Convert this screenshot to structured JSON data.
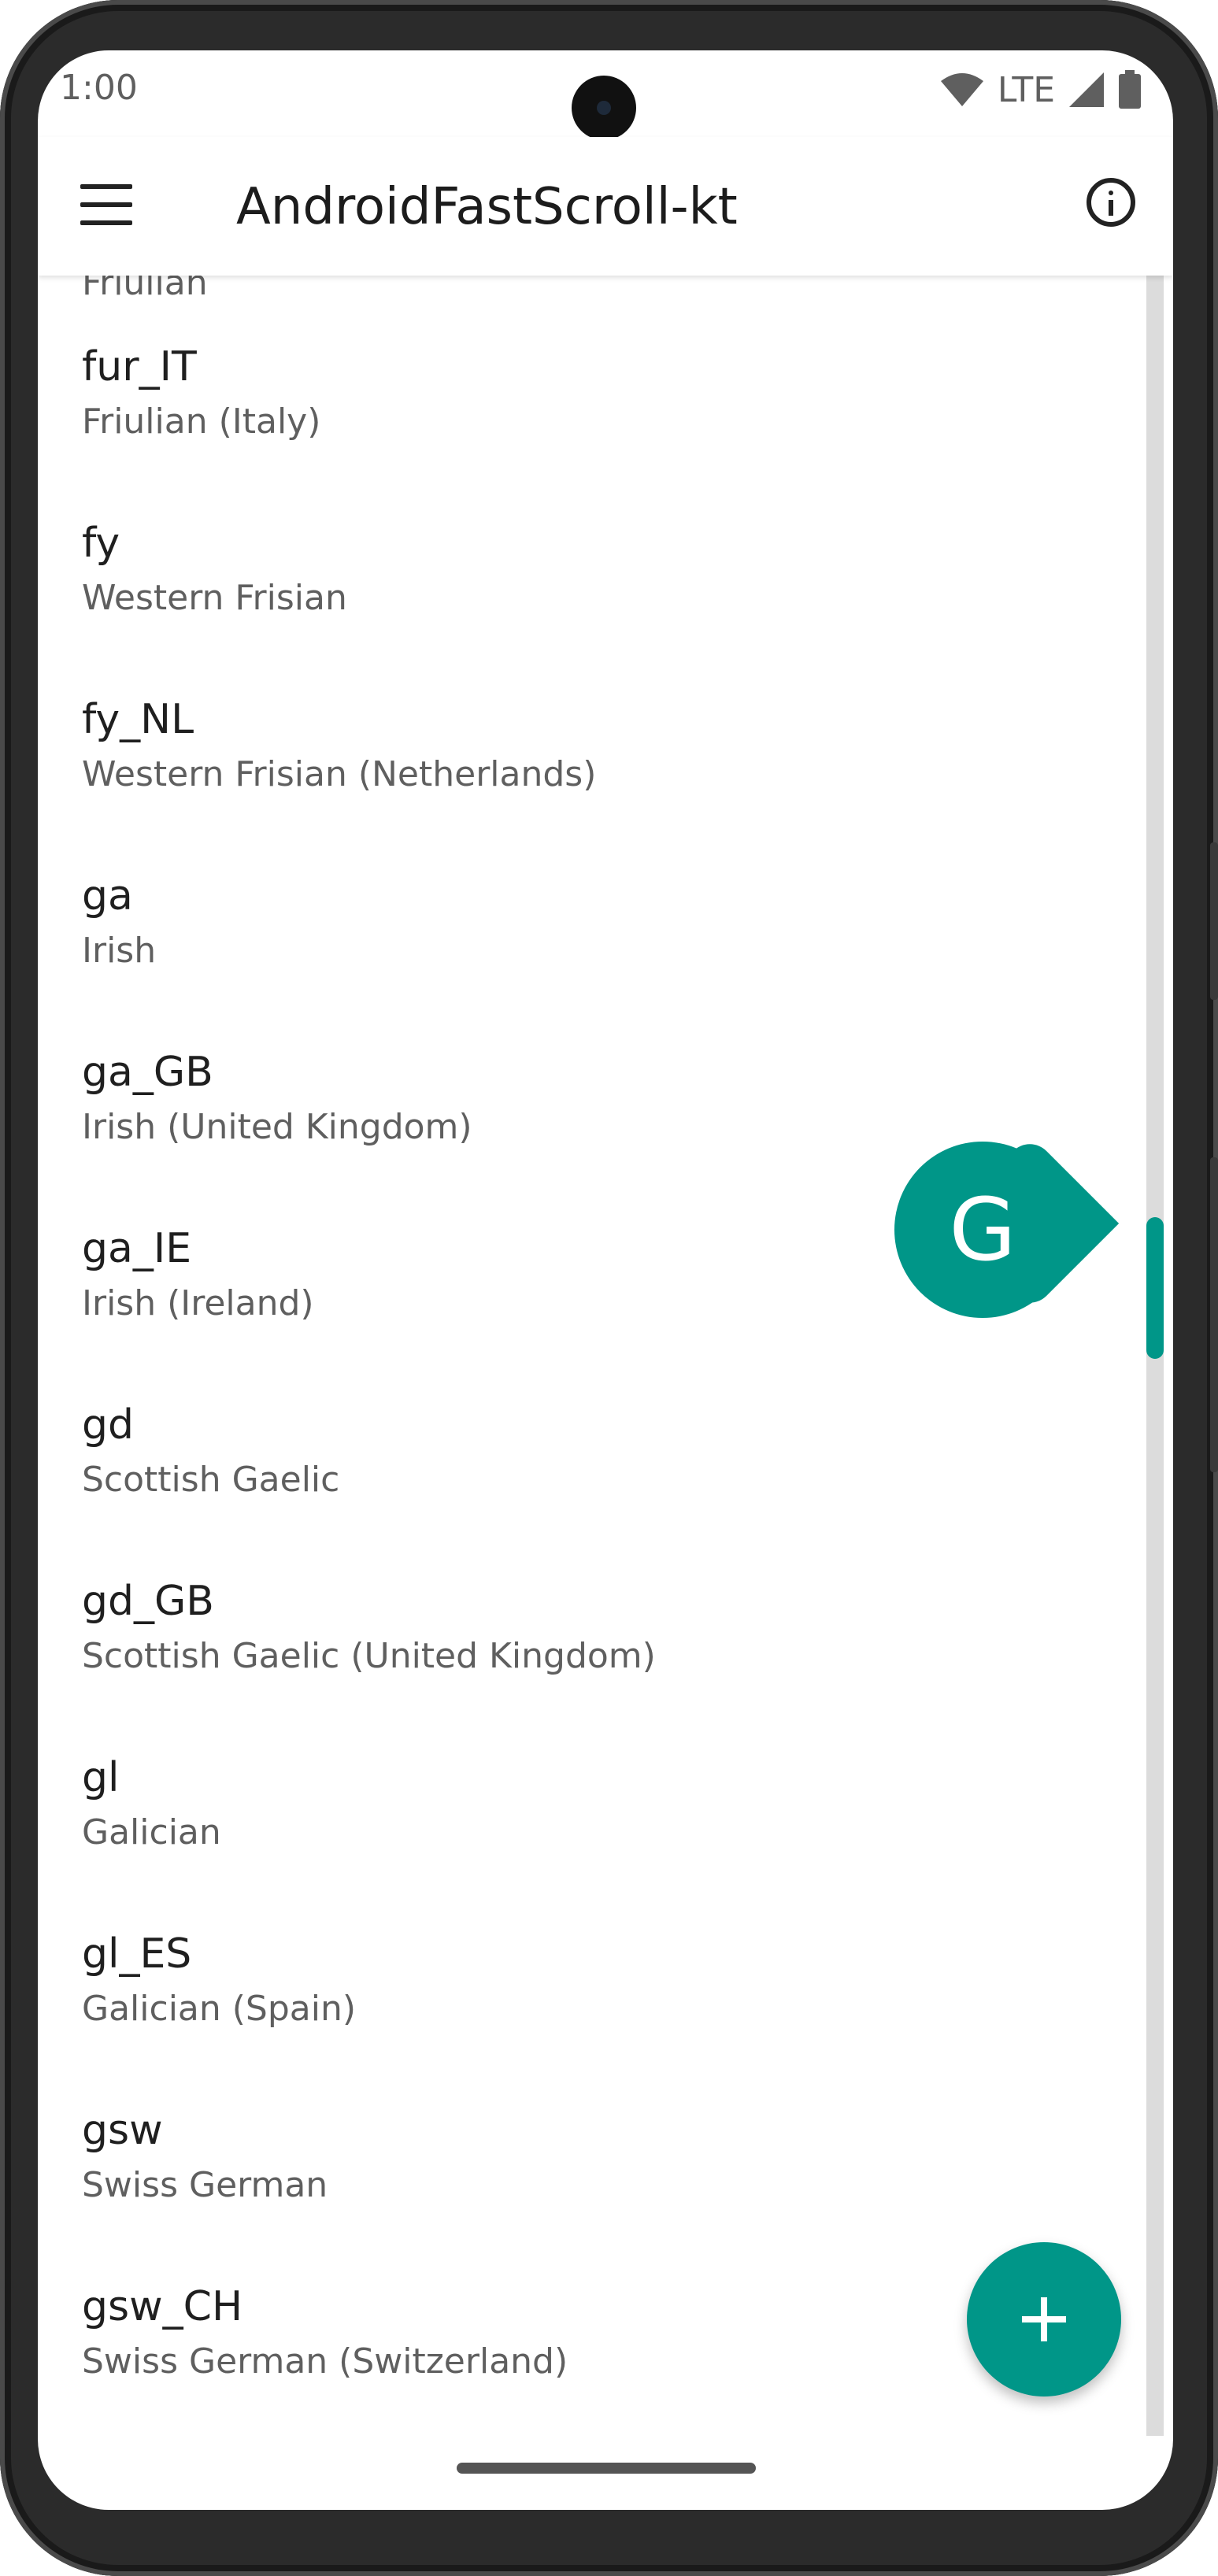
{
  "status_bar": {
    "time": "1:00",
    "network": "LTE"
  },
  "app_bar": {
    "title": "AndroidFastScroll-kt"
  },
  "list": {
    "partial_top_subtitle": "Friulian",
    "items": [
      {
        "code": "fur_IT",
        "name": "Friulian (Italy)"
      },
      {
        "code": "fy",
        "name": "Western Frisian"
      },
      {
        "code": "fy_NL",
        "name": "Western Frisian (Netherlands)"
      },
      {
        "code": "ga",
        "name": "Irish"
      },
      {
        "code": "ga_GB",
        "name": "Irish (United Kingdom)"
      },
      {
        "code": "ga_IE",
        "name": "Irish (Ireland)"
      },
      {
        "code": "gd",
        "name": "Scottish Gaelic"
      },
      {
        "code": "gd_GB",
        "name": "Scottish Gaelic (United Kingdom)"
      },
      {
        "code": "gl",
        "name": "Galician"
      },
      {
        "code": "gl_ES",
        "name": "Galician (Spain)"
      },
      {
        "code": "gsw",
        "name": "Swiss German"
      },
      {
        "code": "gsw_CH",
        "name": "Swiss German (Switzerland)"
      }
    ]
  },
  "fast_scroll": {
    "popup_letter": "G"
  },
  "colors": {
    "accent": "#009688",
    "text_primary": "#1f1f1f",
    "text_secondary": "#5f5f5f"
  },
  "icons": {
    "menu": "menu-icon",
    "info": "info-icon",
    "add": "add-icon",
    "wifi": "wifi-icon",
    "signal": "signal-icon",
    "battery": "battery-icon"
  }
}
